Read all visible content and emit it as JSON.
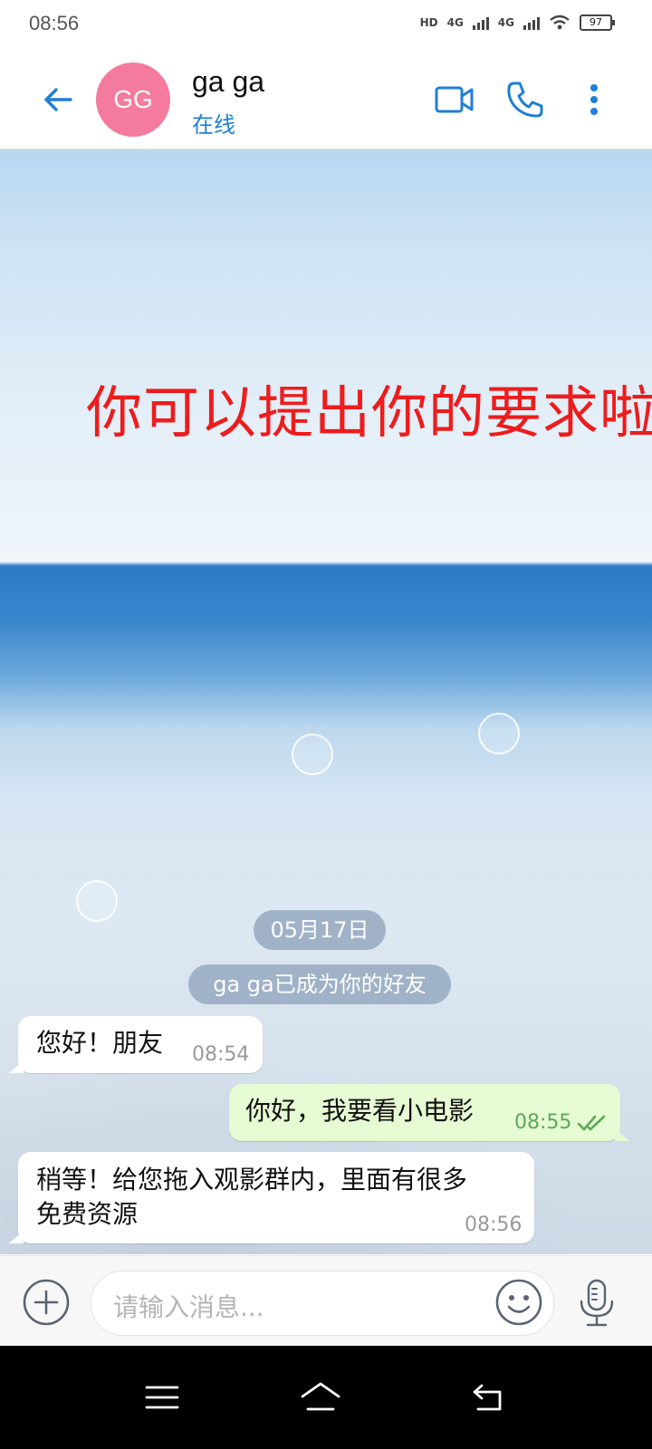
{
  "status_bar": {
    "time": "08:56",
    "network_tag": "HD",
    "signal_1": "4G",
    "signal_2": "4G",
    "battery": "97"
  },
  "header": {
    "avatar_initials": "GG",
    "contact_name": "ga ga",
    "contact_status": "在线"
  },
  "chat": {
    "background_banner": "你可以提出你的要求啦",
    "date_pill": "05月17日",
    "system_notice": "ga ga已成为你的好友",
    "messages": [
      {
        "direction": "incoming",
        "text": "您好！朋友",
        "time": "08:54"
      },
      {
        "direction": "outgoing",
        "text": "你好，我要看小电影",
        "time": "08:55",
        "read": true
      },
      {
        "direction": "incoming",
        "text_line1": "稍等！给您拖入观影群内，里面有很多",
        "text_line2": "免费资源",
        "time": "08:56"
      }
    ]
  },
  "input_bar": {
    "placeholder": "请输入消息..."
  },
  "icons": {
    "back": "arrow-left-icon",
    "video": "video-camera-icon",
    "call": "phone-icon",
    "more": "more-vertical-icon",
    "attach": "plus-circle-icon",
    "emoji": "smiley-icon",
    "voice": "microphone-icon"
  },
  "colors": {
    "accent": "#1e7fd6",
    "avatar_bg": "#f47b9e",
    "banner_text": "#ee1c1c",
    "outgoing_bubble": "#e6fad3",
    "read_tick": "#5da85a"
  }
}
